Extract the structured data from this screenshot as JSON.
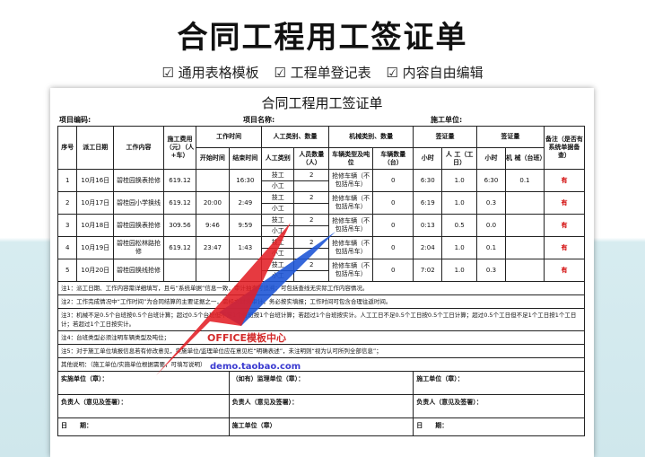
{
  "hero": {
    "title": "合同工程用工签证单",
    "tags": [
      "☑ 通用表格模板",
      "☑ 工程单登记表",
      "☑ 内容自由编辑"
    ]
  },
  "sheet": {
    "title": "合同工程用工签证单",
    "project_no": "项目编码:",
    "project_name": "项目名称:",
    "construction_unit": "施工单位:"
  },
  "headers": {
    "seq": "序号",
    "date": "派工日期",
    "content": "工作内容",
    "cost": "施工费用（元）（人+车）",
    "time": "工作时间",
    "start": "开始时间",
    "end": "结束时间",
    "labor": "人工类别、数量",
    "labor_type": "人工类别",
    "labor_count": "人员数量（人）",
    "mech": "机械类别、数量",
    "vehicle_type": "车辆类型及吨位",
    "vehicle_count": "车辆数量（台）",
    "sign1": "签证量",
    "hour1": "小时",
    "workday": "人 工（工日）",
    "sign2": "签证量",
    "hour2": "小时",
    "machine": "机 械（台班）",
    "remark": "备注（是否有系统单据备查）"
  },
  "rows": [
    {
      "no": "1",
      "date": "10月16日",
      "content": "碧桂园换表抢修",
      "cost": "619.12",
      "start": "",
      "end": "16:30",
      "labor1": "技工",
      "count1": "2",
      "labor2": "小工",
      "vehicle": "抢修车辆（不包括吊车）",
      "vcount": "0",
      "h1": "6:30",
      "day": "1.0",
      "h2": "6:30",
      "mach": "0.1",
      "remark": "有"
    },
    {
      "no": "2",
      "date": "10月17日",
      "content": "碧桂园小学换线",
      "cost": "619.12",
      "start": "20:00",
      "end": "2:49",
      "labor1": "技工",
      "count1": "2",
      "labor2": "小工",
      "vehicle": "抢修车辆（不包括吊车）",
      "vcount": "0",
      "h1": "6:19",
      "day": "1.0",
      "h2": "0.3",
      "mach": "",
      "remark": "有"
    },
    {
      "no": "3",
      "date": "10月18日",
      "content": "碧桂园换表抢修",
      "cost": "309.56",
      "start": "9:46",
      "end": "9:59",
      "labor1": "技工",
      "count1": "2",
      "labor2": "小工",
      "vehicle": "抢修车辆（不包括吊车）",
      "vcount": "0",
      "h1": "0:13",
      "day": "0.5",
      "h2": "0.0",
      "mach": "",
      "remark": "有"
    },
    {
      "no": "4",
      "date": "10月19日",
      "content": "碧桂园松林路抢修",
      "cost": "619.12",
      "start": "23:47",
      "end": "1:43",
      "labor1": "技工",
      "count1": "2",
      "labor2": "小工",
      "vehicle": "抢修车辆（不包括吊车）",
      "vcount": "0",
      "h1": "2:04",
      "day": "1.0",
      "h2": "0.1",
      "mach": "",
      "remark": "有"
    },
    {
      "no": "5",
      "date": "10月20日",
      "content": "碧桂园换线抢修",
      "cost": "",
      "start": "",
      "end": "",
      "labor1": "技工",
      "count1": "2",
      "labor2": "小工",
      "vehicle": "抢修车辆（不包括吊车）",
      "vcount": "0",
      "h1": "7:02",
      "day": "1.0",
      "h2": "0.3",
      "mach": "",
      "remark": "有"
    }
  ],
  "notes": [
    "注1：派工日期、工作内容需详细填写，且与“系统单据”信息一致，审计抽查可追溯；可包括查线无实际工作内容情况。",
    "注2：工作完成情况中“工作时间”为合同结算的主要证据之一，需经文财务审计，务必按实填报；工作时间可包含合理往返时间。",
    "注3：机械不足0.5个台班按0.5个台班计算；超过0.5个台班但不足1个台班按1个台班计算；若超过1个台班按实计。人工工日不足0.5个工日按0.5个工日计算；超过0.5个工日但不足1个工日按1个工日计；若超过1个工日按实计。",
    "注4：台班类型必须注明车辆类型及吨位；",
    "注5：对于施工单位填报信息若有修改意见，实施单位/监理单位应在意见栏“明确表述”，未注明则“视为认可所列全部信息”；",
    "其他说明：（施工单位/实施单位根据需要，可填写说明）"
  ],
  "sign": {
    "impl": "实施单位（章）：",
    "supervisor": "（如有）监理单位（章）：",
    "builder": "施工单位（章）：",
    "resp1": "负责人（意见及签署）：",
    "resp2": "负责人（意见及签署）：",
    "resp3": "负责人（意见及签署）：",
    "date1": "日　　期：",
    "builder2": "施工单位（章）",
    "date3": "日　　期："
  },
  "watermark": {
    "brand": "OFFICE模板中心",
    "url": "demo.taobao.com",
    "arrow_colors": [
      "#1f57d6",
      "#e21f26"
    ]
  }
}
